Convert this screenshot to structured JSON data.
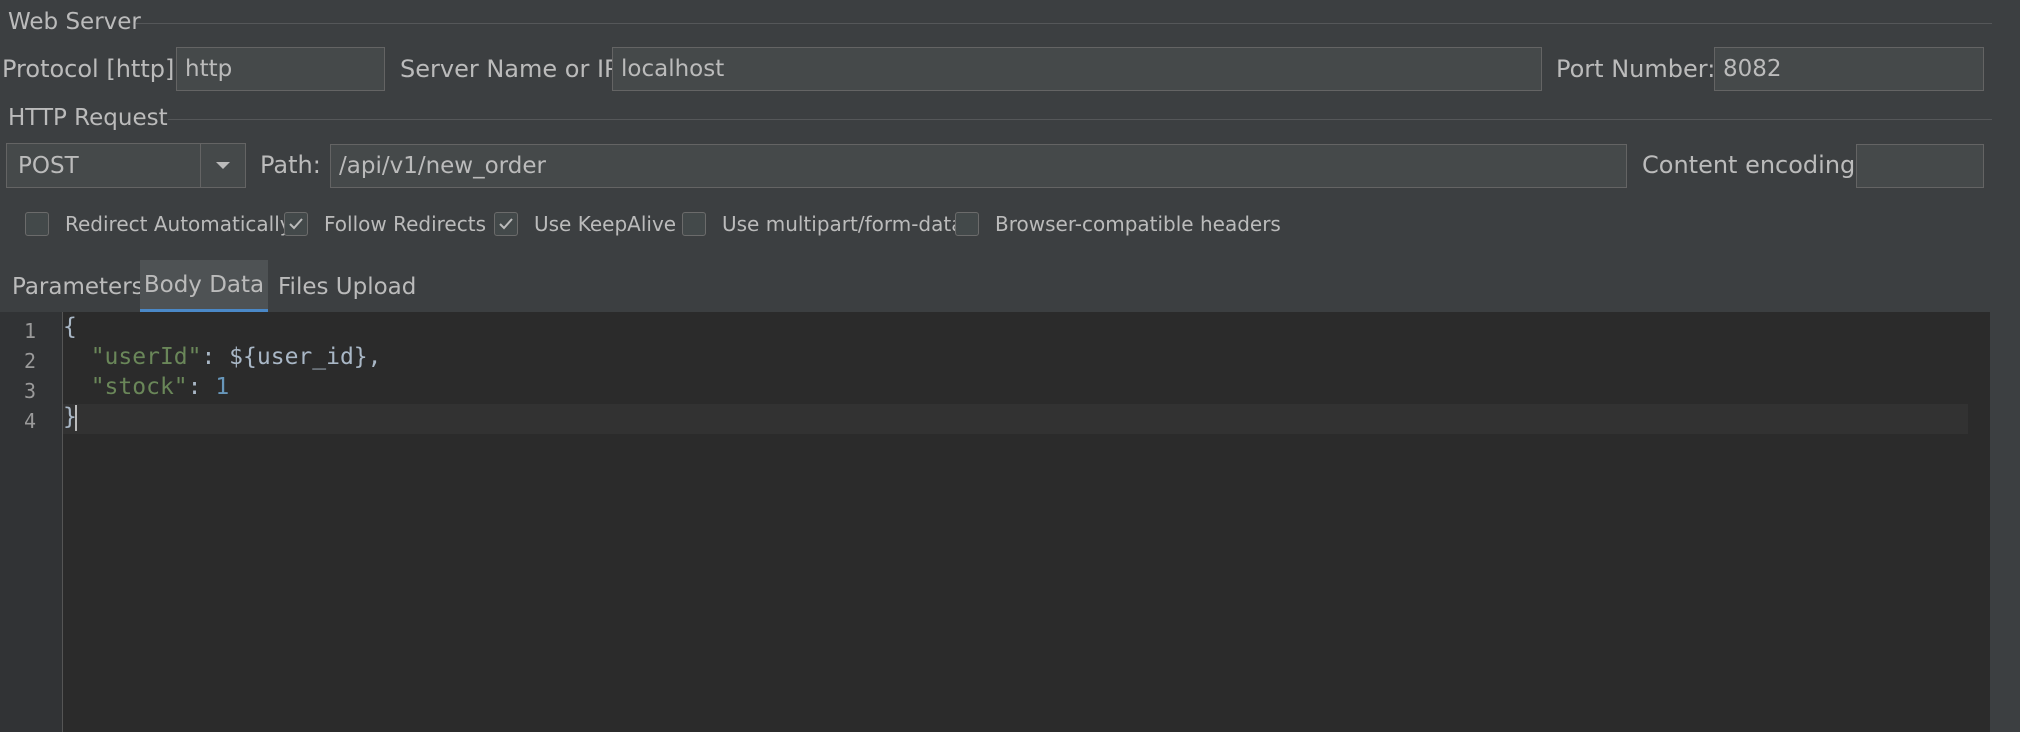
{
  "web_server": {
    "title": "Web Server",
    "protocol_label": "Protocol [http]:",
    "protocol_value": "http",
    "server_label": "Server Name or IP:",
    "server_value": "localhost",
    "port_label": "Port Number:",
    "port_value": "8082"
  },
  "http_request": {
    "title": "HTTP Request",
    "method": "POST",
    "path_label": "Path:",
    "path_value": "/api/v1/new_order",
    "encoding_label": "Content encoding:",
    "encoding_value": ""
  },
  "options": [
    {
      "label": "Redirect Automatically",
      "checked": false
    },
    {
      "label": "Follow Redirects",
      "checked": true
    },
    {
      "label": "Use KeepAlive",
      "checked": true
    },
    {
      "label": "Use multipart/form-data",
      "checked": false
    },
    {
      "label": "Browser-compatible headers",
      "checked": false
    }
  ],
  "tabs": [
    {
      "label": "Parameters",
      "active": false
    },
    {
      "label": "Body Data",
      "active": true
    },
    {
      "label": "Files Upload",
      "active": false
    }
  ],
  "editor": {
    "line_numbers": [
      "1",
      "2",
      "3",
      "4"
    ],
    "lines": {
      "l1": "{",
      "l2_key": "\"userId\"",
      "l2_rest": ": ${user_id},",
      "l3_key": "\"stock\"",
      "l3_sep": ": ",
      "l3_val": "1",
      "l4": "}"
    }
  },
  "colors": {
    "background": "#3c3f41",
    "editor_bg": "#2b2b2b",
    "string": "#6a8759",
    "number": "#6897bb",
    "tab_accent": "#4a88c7"
  }
}
